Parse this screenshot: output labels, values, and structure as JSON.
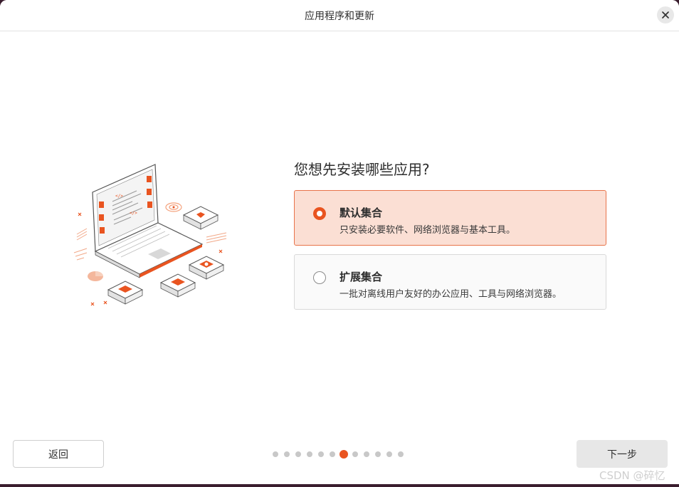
{
  "window": {
    "title": "应用程序和更新",
    "close_icon": "close-icon"
  },
  "main": {
    "question": "您想先安装哪些应用?",
    "options": [
      {
        "title": "默认集合",
        "description": "只安装必要软件、网络浏览器与基本工具。",
        "selected": true
      },
      {
        "title": "扩展集合",
        "description": "一批对离线用户友好的办公应用、工具与网络浏览器。",
        "selected": false
      }
    ]
  },
  "footer": {
    "back_label": "返回",
    "next_label": "下一步",
    "progress": {
      "total_steps": 12,
      "current_step": 7
    }
  },
  "watermark": "CSDN @碎忆",
  "colors": {
    "accent": "#e95420",
    "selected_bg": "#fbdfd4",
    "selected_border": "#e8734a"
  }
}
